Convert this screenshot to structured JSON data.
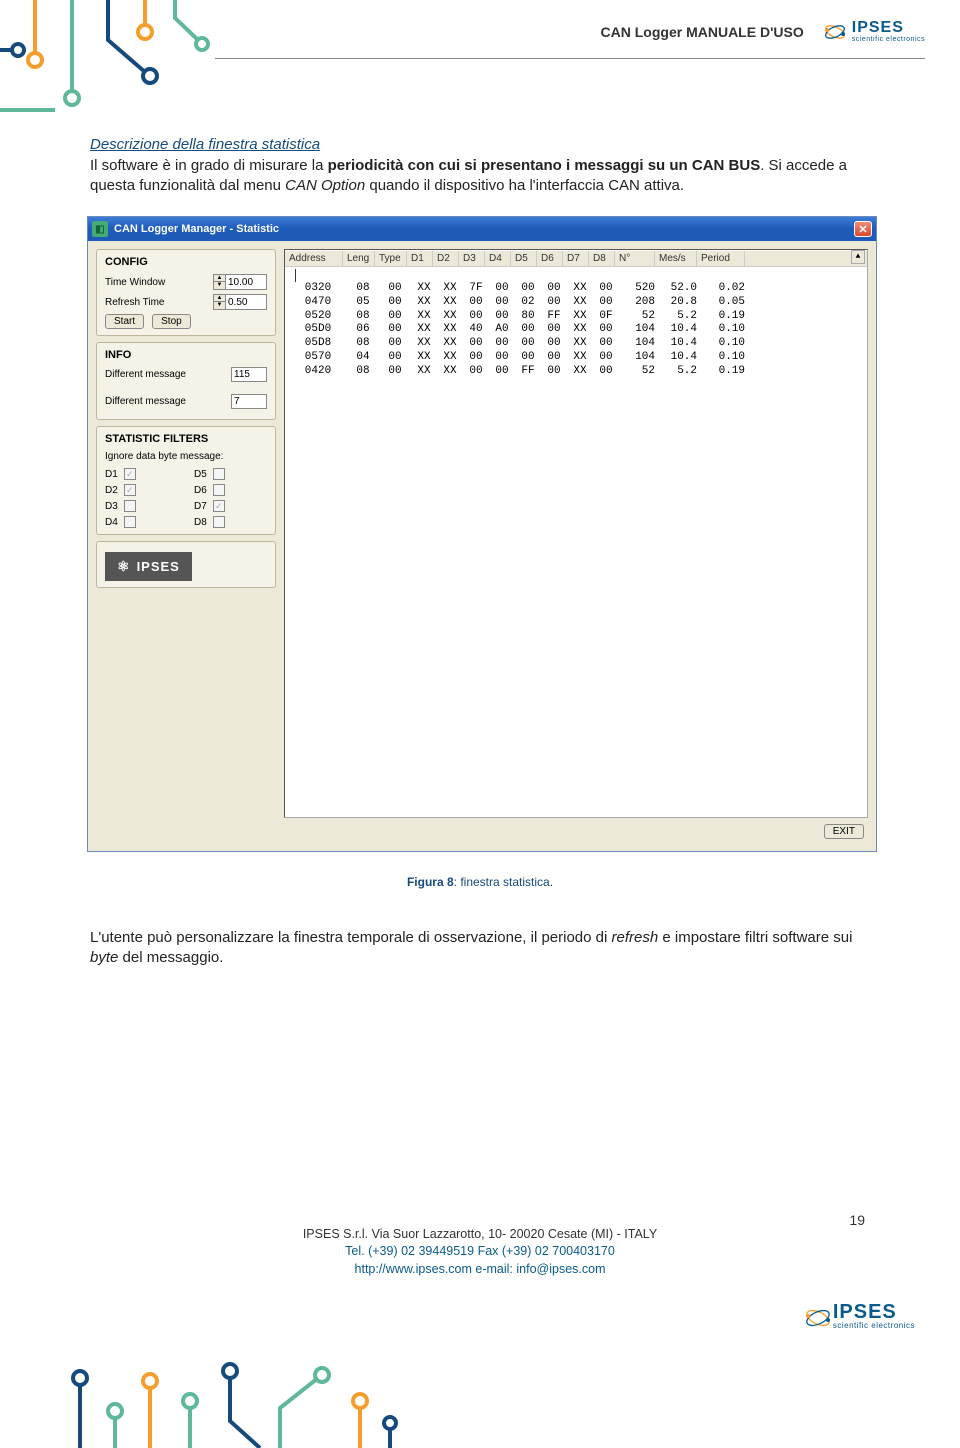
{
  "header": {
    "doc_title": "CAN Logger MANUALE D'USO",
    "logo_main": "IPSES",
    "logo_sub": "scientific electronics"
  },
  "section_title": "Descrizione della finestra statistica",
  "para1_pre": "Il software è in grado di misurare la ",
  "para1_bold": "periodicità con cui si presentano i messaggi su un CAN BUS",
  "para1_post": ". Si accede a questa funzionalità dal menu ",
  "para1_it": "CAN Option",
  "para1_end": " quando il dispositivo ha l'interfaccia CAN attiva.",
  "window": {
    "title": "CAN Logger Manager  -  Statistic",
    "close": "✕",
    "config": {
      "title": "CONFIG",
      "tw_label": "Time Window",
      "tw_val": "10.00",
      "rt_label": "Refresh Time",
      "rt_val": "0.50",
      "start": "Start",
      "stop": "Stop"
    },
    "info": {
      "title": "INFO",
      "dm1_label": "Different message",
      "dm1_val": "115",
      "dm2_label": "Different message",
      "dm2_val": "7"
    },
    "filters": {
      "title": "STATISTIC FILTERS",
      "subtitle": "Ignore data byte message:",
      "items": [
        "D1",
        "D2",
        "D3",
        "D4",
        "D5",
        "D6",
        "D7",
        "D8"
      ],
      "checked": {
        "D1": true,
        "D2": true,
        "D7": true
      }
    },
    "table": {
      "headers": [
        "Address",
        "Leng",
        "Type",
        "D1",
        "D2",
        "D3",
        "D4",
        "D5",
        "D6",
        "D7",
        "D8",
        "N°",
        "Mes/s",
        "Period"
      ],
      "rows": [
        [
          "0320",
          "08",
          "00",
          "XX",
          "XX",
          "7F",
          "00",
          "00",
          "00",
          "XX",
          "00",
          "520",
          "52.0",
          "0.02"
        ],
        [
          "0470",
          "05",
          "00",
          "XX",
          "XX",
          "00",
          "00",
          "02",
          "00",
          "XX",
          "00",
          "208",
          "20.8",
          "0.05"
        ],
        [
          "0520",
          "08",
          "00",
          "XX",
          "XX",
          "00",
          "00",
          "80",
          "FF",
          "XX",
          "0F",
          "52",
          "5.2",
          "0.19"
        ],
        [
          "05D0",
          "06",
          "00",
          "XX",
          "XX",
          "40",
          "A0",
          "00",
          "00",
          "XX",
          "00",
          "104",
          "10.4",
          "0.10"
        ],
        [
          "05D8",
          "08",
          "00",
          "XX",
          "XX",
          "00",
          "00",
          "00",
          "00",
          "XX",
          "00",
          "104",
          "10.4",
          "0.10"
        ],
        [
          "0570",
          "04",
          "00",
          "XX",
          "XX",
          "00",
          "00",
          "00",
          "00",
          "XX",
          "00",
          "104",
          "10.4",
          "0.10"
        ],
        [
          "0420",
          "08",
          "00",
          "XX",
          "XX",
          "00",
          "00",
          "FF",
          "00",
          "XX",
          "00",
          "52",
          "5.2",
          "0.19"
        ]
      ]
    },
    "ipses_badge": "IPSES",
    "exit": "EXIT"
  },
  "caption_b": "Figura 8",
  "caption_rest": ": finestra statistica.",
  "para2_pre": "L'utente può personalizzare la finestra temporale di osservazione, il periodo di ",
  "para2_it1": "refresh",
  "para2_mid": " e impostare filtri software sui ",
  "para2_it2": "byte",
  "para2_end": " del messaggio.",
  "footer": {
    "line1": "IPSES S.r.l. Via Suor Lazzarotto, 10- 20020 Cesate (MI) - ITALY",
    "line2": "Tel. (+39) 02 39449519   Fax (+39) 02 700403170",
    "line3": "http://www.ipses.com   e-mail: info@ipses.com"
  },
  "page": "19"
}
